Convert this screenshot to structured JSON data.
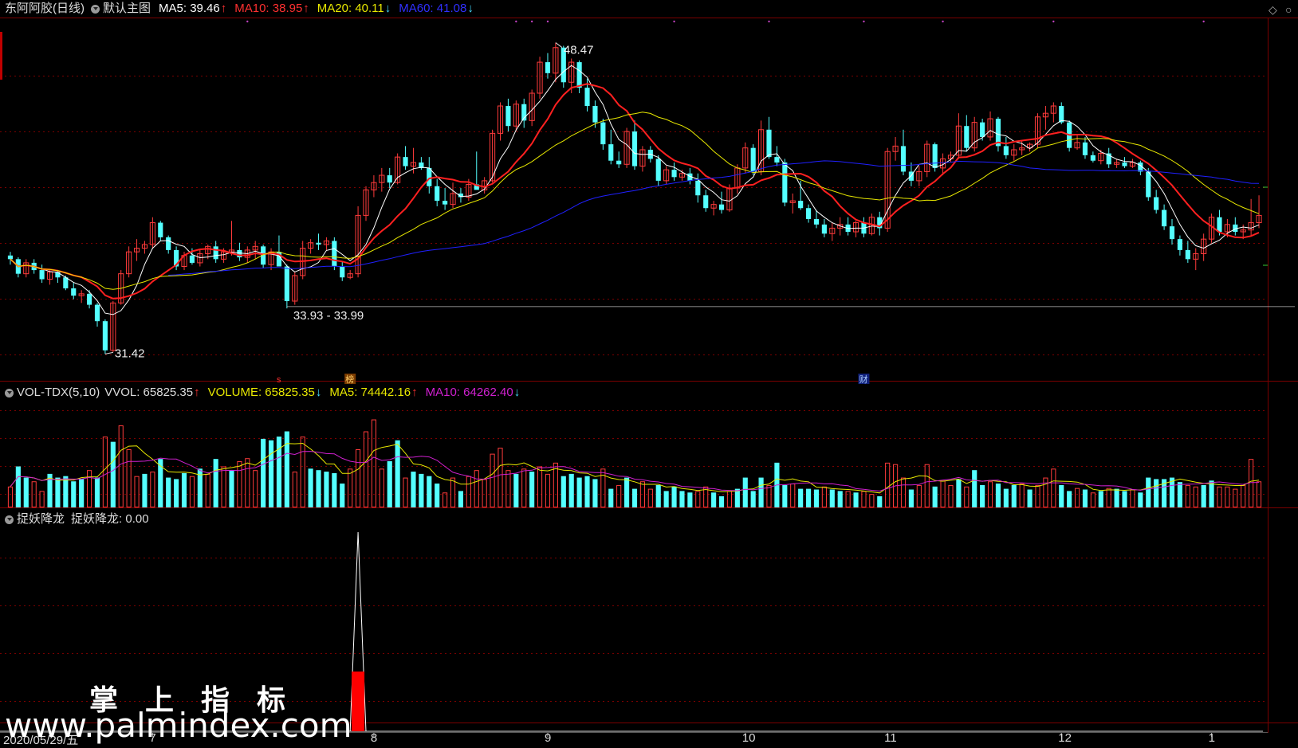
{
  "header_main": {
    "stock": "东阿阿胶(日线)",
    "chart_name": "默认主图",
    "ma5": "MA5: 39.46",
    "ma10": "MA10: 38.95",
    "ma20": "MA20: 40.11",
    "ma60": "MA60: 41.08"
  },
  "header_vol": {
    "name": "VOL-TDX(5,10)",
    "vvol": "VVOL: 65825.35",
    "volume": "VOLUME: 65825.35",
    "ma5": "MA5: 74442.16",
    "ma10": "MA10: 64262.40"
  },
  "header_ind": {
    "name": "捉妖降龙",
    "value": "捉妖降龙: 0.00"
  },
  "annotations": {
    "high": "48.47",
    "low": "31.42",
    "range": "33.93 - 33.99",
    "marker_s": "s",
    "marker_bang": "榜",
    "marker_cai": "财"
  },
  "x_axis": {
    "date": "2020/05/29/五",
    "months": [
      "7",
      "8",
      "9",
      "10",
      "11",
      "12",
      "1"
    ]
  },
  "watermark": {
    "line1": "掌上指标",
    "line2": "www.palmindex.com"
  },
  "colors": {
    "up": "#ff3b3b",
    "down": "#54ffff",
    "ma5": "#ffffff",
    "ma10": "#ff2020",
    "ma20": "#e8e800",
    "ma60": "#2020ff",
    "vol_ma5": "#e8e800",
    "vol_ma10": "#d020d0",
    "grid": "#7a0000"
  },
  "chart_data": {
    "type": "candlestick",
    "y_range": [
      30.5,
      49.5
    ],
    "candles": [
      [
        36.8,
        37.0,
        36.3,
        36.6
      ],
      [
        36.6,
        36.7,
        35.6,
        35.8
      ],
      [
        35.8,
        36.6,
        35.6,
        36.4
      ],
      [
        36.4,
        36.6,
        35.8,
        36.0
      ],
      [
        36.0,
        36.3,
        35.3,
        35.5
      ],
      [
        35.5,
        36.0,
        35.2,
        35.9
      ],
      [
        35.9,
        36.0,
        35.3,
        35.6
      ],
      [
        35.6,
        35.7,
        34.9,
        35.0
      ],
      [
        35.0,
        35.3,
        34.4,
        34.6
      ],
      [
        34.6,
        34.9,
        34.2,
        34.7
      ],
      [
        34.7,
        34.9,
        33.9,
        34.1
      ],
      [
        34.1,
        34.2,
        32.9,
        33.2
      ],
      [
        33.2,
        33.3,
        31.4,
        31.6
      ],
      [
        31.6,
        34.3,
        31.5,
        34.2
      ],
      [
        34.2,
        36.0,
        34.1,
        35.8
      ],
      [
        35.8,
        37.3,
        35.6,
        37.0
      ],
      [
        37.0,
        37.7,
        36.5,
        37.2
      ],
      [
        37.2,
        37.6,
        36.9,
        37.4
      ],
      [
        37.4,
        38.9,
        37.2,
        38.6
      ],
      [
        38.6,
        38.7,
        37.6,
        37.8
      ],
      [
        37.8,
        37.9,
        36.9,
        37.1
      ],
      [
        37.1,
        37.3,
        36.0,
        36.2
      ],
      [
        36.2,
        37.0,
        36.0,
        36.8
      ],
      [
        36.8,
        37.2,
        36.3,
        36.4
      ],
      [
        36.4,
        37.1,
        36.2,
        36.9
      ],
      [
        36.9,
        37.4,
        36.6,
        37.3
      ],
      [
        37.3,
        37.6,
        36.4,
        36.6
      ],
      [
        36.6,
        37.2,
        36.4,
        37.0
      ],
      [
        37.0,
        38.7,
        36.8,
        37.1
      ],
      [
        37.1,
        37.5,
        36.5,
        36.7
      ],
      [
        36.7,
        37.3,
        36.4,
        37.1
      ],
      [
        37.1,
        37.6,
        36.6,
        37.3
      ],
      [
        37.3,
        37.4,
        36.1,
        36.3
      ],
      [
        36.3,
        37.2,
        36.0,
        37.0
      ],
      [
        37.0,
        37.9,
        36.3,
        36.2
      ],
      [
        36.2,
        36.3,
        33.9,
        34.3
      ],
      [
        34.3,
        35.9,
        34.1,
        35.7
      ],
      [
        35.7,
        37.6,
        35.5,
        37.2
      ],
      [
        37.2,
        37.7,
        36.9,
        37.5
      ],
      [
        37.5,
        38.0,
        37.1,
        37.4
      ],
      [
        37.4,
        37.8,
        37.1,
        37.6
      ],
      [
        37.6,
        37.8,
        36.0,
        36.2
      ],
      [
        36.2,
        36.5,
        35.4,
        35.6
      ],
      [
        35.6,
        36.0,
        35.5,
        35.8
      ],
      [
        35.8,
        39.5,
        35.6,
        39.0
      ],
      [
        39.0,
        40.6,
        38.7,
        40.4
      ],
      [
        40.4,
        41.2,
        40.0,
        40.8
      ],
      [
        40.8,
        41.6,
        40.3,
        41.2
      ],
      [
        41.2,
        41.6,
        40.5,
        40.8
      ],
      [
        40.8,
        42.4,
        40.7,
        42.2
      ],
      [
        42.2,
        42.8,
        41.5,
        41.7
      ],
      [
        41.7,
        42.7,
        41.3,
        41.9
      ],
      [
        41.9,
        42.2,
        41.5,
        41.6
      ],
      [
        41.6,
        42.2,
        40.2,
        40.6
      ],
      [
        40.6,
        41.0,
        39.5,
        39.8
      ],
      [
        39.8,
        40.5,
        39.3,
        39.6
      ],
      [
        39.6,
        40.8,
        39.4,
        40.2
      ],
      [
        40.2,
        40.5,
        39.7,
        40.0
      ],
      [
        40.0,
        41.0,
        39.8,
        40.7
      ],
      [
        40.7,
        42.5,
        40.5,
        40.4
      ],
      [
        40.4,
        41.1,
        40.2,
        40.9
      ],
      [
        40.9,
        43.7,
        40.8,
        43.5
      ],
      [
        43.5,
        45.2,
        43.1,
        45.0
      ],
      [
        45.0,
        45.4,
        43.6,
        43.9
      ],
      [
        43.9,
        45.3,
        43.6,
        45.1
      ],
      [
        45.1,
        45.4,
        43.8,
        44.2
      ],
      [
        44.2,
        45.9,
        43.9,
        45.7
      ],
      [
        45.7,
        47.7,
        45.4,
        47.4
      ],
      [
        47.4,
        47.9,
        46.5,
        46.8
      ],
      [
        46.8,
        48.47,
        46.3,
        48.2
      ],
      [
        48.2,
        48.3,
        46.0,
        46.3
      ],
      [
        46.3,
        47.6,
        45.7,
        47.4
      ],
      [
        47.4,
        47.5,
        45.7,
        46.0
      ],
      [
        46.0,
        46.5,
        44.7,
        45.0
      ],
      [
        45.0,
        45.3,
        43.8,
        44.1
      ],
      [
        44.1,
        44.3,
        42.6,
        42.9
      ],
      [
        42.9,
        43.7,
        41.8,
        42.0
      ],
      [
        42.0,
        42.5,
        41.6,
        41.8
      ],
      [
        41.8,
        43.8,
        41.6,
        43.6
      ],
      [
        43.6,
        44.2,
        41.5,
        41.7
      ],
      [
        41.7,
        42.8,
        41.4,
        42.6
      ],
      [
        42.6,
        42.8,
        41.9,
        42.1
      ],
      [
        42.1,
        42.3,
        40.6,
        40.9
      ],
      [
        40.9,
        41.7,
        40.7,
        41.5
      ],
      [
        41.5,
        41.9,
        40.9,
        41.1
      ],
      [
        41.1,
        41.5,
        40.9,
        41.3
      ],
      [
        41.3,
        41.6,
        40.7,
        40.9
      ],
      [
        40.9,
        41.3,
        39.7,
        40.1
      ],
      [
        40.1,
        40.4,
        39.2,
        39.4
      ],
      [
        39.4,
        39.8,
        39.0,
        39.6
      ],
      [
        39.6,
        40.3,
        39.1,
        39.3
      ],
      [
        39.3,
        40.7,
        39.2,
        40.5
      ],
      [
        40.5,
        41.8,
        40.2,
        41.6
      ],
      [
        41.6,
        43.0,
        41.3,
        42.7
      ],
      [
        42.7,
        42.9,
        41.2,
        41.4
      ],
      [
        41.4,
        44.2,
        41.2,
        43.7
      ],
      [
        43.7,
        44.4,
        42.1,
        42.2
      ],
      [
        42.2,
        42.8,
        41.7,
        41.9
      ],
      [
        41.9,
        42.1,
        39.5,
        39.7
      ],
      [
        39.7,
        40.2,
        39.1,
        39.8
      ],
      [
        39.8,
        40.9,
        39.3,
        39.4
      ],
      [
        39.4,
        39.6,
        38.6,
        38.8
      ],
      [
        38.8,
        39.3,
        38.3,
        38.5
      ],
      [
        38.5,
        38.8,
        37.8,
        38.0
      ],
      [
        38.0,
        38.6,
        37.6,
        38.3
      ],
      [
        38.3,
        38.9,
        37.9,
        38.5
      ],
      [
        38.5,
        38.9,
        37.9,
        38.1
      ],
      [
        38.1,
        38.7,
        37.8,
        38.6
      ],
      [
        38.6,
        38.9,
        37.8,
        38.0
      ],
      [
        38.0,
        39.1,
        37.9,
        38.9
      ],
      [
        38.9,
        39.2,
        37.9,
        38.3
      ],
      [
        38.3,
        42.7,
        38.1,
        42.5
      ],
      [
        42.5,
        43.3,
        42.0,
        42.8
      ],
      [
        42.8,
        43.7,
        41.2,
        41.4
      ],
      [
        41.4,
        41.9,
        40.6,
        40.9
      ],
      [
        40.9,
        41.7,
        40.6,
        41.4
      ],
      [
        41.4,
        43.1,
        41.1,
        42.9
      ],
      [
        42.9,
        43.0,
        41.4,
        41.6
      ],
      [
        41.6,
        42.4,
        41.2,
        42.1
      ],
      [
        42.1,
        42.5,
        41.9,
        42.3
      ],
      [
        42.3,
        44.6,
        42.1,
        43.9
      ],
      [
        43.9,
        44.5,
        42.5,
        42.7
      ],
      [
        42.7,
        44.4,
        42.5,
        44.1
      ],
      [
        44.1,
        44.3,
        43.1,
        43.3
      ],
      [
        43.3,
        44.7,
        43.1,
        44.3
      ],
      [
        44.3,
        44.4,
        42.5,
        42.8
      ],
      [
        42.8,
        43.3,
        42.1,
        42.3
      ],
      [
        42.3,
        42.9,
        42.0,
        42.6
      ],
      [
        42.6,
        43.1,
        42.3,
        42.7
      ],
      [
        42.7,
        43.0,
        42.5,
        42.9
      ],
      [
        42.9,
        44.6,
        42.7,
        44.4
      ],
      [
        44.4,
        45.0,
        43.7,
        44.6
      ],
      [
        44.6,
        45.2,
        44.1,
        45.0
      ],
      [
        45.0,
        45.2,
        44.0,
        44.1
      ],
      [
        44.1,
        44.2,
        42.5,
        42.7
      ],
      [
        42.7,
        43.4,
        42.6,
        43.0
      ],
      [
        43.0,
        43.3,
        42.1,
        42.3
      ],
      [
        42.3,
        42.5,
        41.9,
        42.0
      ],
      [
        42.0,
        42.6,
        41.8,
        42.4
      ],
      [
        42.4,
        42.7,
        41.6,
        41.8
      ],
      [
        41.8,
        42.1,
        41.6,
        41.9
      ],
      [
        41.9,
        42.2,
        41.6,
        41.7
      ],
      [
        41.7,
        42.1,
        41.6,
        41.9
      ],
      [
        41.9,
        42.0,
        41.2,
        41.4
      ],
      [
        41.4,
        41.6,
        39.8,
        40.0
      ],
      [
        40.0,
        40.4,
        39.1,
        39.3
      ],
      [
        39.3,
        39.6,
        38.2,
        38.4
      ],
      [
        38.4,
        38.8,
        37.4,
        37.7
      ],
      [
        37.7,
        37.9,
        36.8,
        37.1
      ],
      [
        37.1,
        37.6,
        36.4,
        36.6
      ],
      [
        36.6,
        37.2,
        36.0,
        36.9
      ],
      [
        36.9,
        38.0,
        36.5,
        37.7
      ],
      [
        37.7,
        39.1,
        37.5,
        38.9
      ],
      [
        38.9,
        39.3,
        37.9,
        38.1
      ],
      [
        38.1,
        38.8,
        37.8,
        38.5
      ],
      [
        38.5,
        38.9,
        37.9,
        38.1
      ],
      [
        38.1,
        38.5,
        37.7,
        38.2
      ],
      [
        38.2,
        39.9,
        37.9,
        38.6
      ],
      [
        38.6,
        40.1,
        38.3,
        39.0
      ]
    ],
    "volumes": [
      [
        28,
        0
      ],
      [
        55,
        1
      ],
      [
        40,
        1
      ],
      [
        35,
        0
      ],
      [
        22,
        0
      ],
      [
        45,
        1
      ],
      [
        40,
        1
      ],
      [
        42,
        1
      ],
      [
        35,
        1
      ],
      [
        38,
        1
      ],
      [
        50,
        0
      ],
      [
        40,
        1
      ],
      [
        95,
        0
      ],
      [
        88,
        1
      ],
      [
        110,
        0
      ],
      [
        78,
        0
      ],
      [
        42,
        0
      ],
      [
        45,
        1
      ],
      [
        48,
        0
      ],
      [
        65,
        1
      ],
      [
        40,
        1
      ],
      [
        38,
        1
      ],
      [
        46,
        1
      ],
      [
        42,
        0
      ],
      [
        52,
        1
      ],
      [
        45,
        0
      ],
      [
        65,
        1
      ],
      [
        55,
        0
      ],
      [
        50,
        1
      ],
      [
        62,
        0
      ],
      [
        66,
        0
      ],
      [
        50,
        0
      ],
      [
        92,
        1
      ],
      [
        90,
        1
      ],
      [
        95,
        1
      ],
      [
        102,
        1
      ],
      [
        48,
        0
      ],
      [
        95,
        0
      ],
      [
        52,
        1
      ],
      [
        50,
        1
      ],
      [
        48,
        1
      ],
      [
        46,
        1
      ],
      [
        32,
        1
      ],
      [
        52,
        0
      ],
      [
        78,
        0
      ],
      [
        102,
        0
      ],
      [
        118,
        0
      ],
      [
        52,
        0
      ],
      [
        62,
        1
      ],
      [
        90,
        1
      ],
      [
        40,
        0
      ],
      [
        48,
        1
      ],
      [
        45,
        1
      ],
      [
        42,
        1
      ],
      [
        32,
        1
      ],
      [
        20,
        0
      ],
      [
        40,
        0
      ],
      [
        22,
        1
      ],
      [
        42,
        0
      ],
      [
        50,
        0
      ],
      [
        38,
        0
      ],
      [
        72,
        0
      ],
      [
        80,
        0
      ],
      [
        50,
        0
      ],
      [
        45,
        1
      ],
      [
        52,
        0
      ],
      [
        48,
        1
      ],
      [
        55,
        0
      ],
      [
        45,
        0
      ],
      [
        60,
        0
      ],
      [
        42,
        1
      ],
      [
        45,
        1
      ],
      [
        40,
        1
      ],
      [
        42,
        1
      ],
      [
        38,
        1
      ],
      [
        52,
        0
      ],
      [
        25,
        1
      ],
      [
        30,
        0
      ],
      [
        40,
        1
      ],
      [
        25,
        1
      ],
      [
        35,
        0
      ],
      [
        25,
        0
      ],
      [
        30,
        1
      ],
      [
        22,
        1
      ],
      [
        28,
        1
      ],
      [
        22,
        1
      ],
      [
        20,
        1
      ],
      [
        22,
        0
      ],
      [
        28,
        0
      ],
      [
        20,
        1
      ],
      [
        15,
        1
      ],
      [
        22,
        0
      ],
      [
        25,
        1
      ],
      [
        40,
        1
      ],
      [
        22,
        1
      ],
      [
        40,
        1
      ],
      [
        30,
        0
      ],
      [
        60,
        1
      ],
      [
        30,
        1
      ],
      [
        32,
        0
      ],
      [
        25,
        1
      ],
      [
        25,
        1
      ],
      [
        24,
        1
      ],
      [
        28,
        0
      ],
      [
        24,
        1
      ],
      [
        22,
        1
      ],
      [
        22,
        0
      ],
      [
        20,
        1
      ],
      [
        22,
        0
      ],
      [
        18,
        0
      ],
      [
        15,
        1
      ],
      [
        60,
        0
      ],
      [
        58,
        0
      ],
      [
        40,
        0
      ],
      [
        24,
        1
      ],
      [
        30,
        0
      ],
      [
        58,
        0
      ],
      [
        28,
        1
      ],
      [
        36,
        0
      ],
      [
        30,
        0
      ],
      [
        38,
        1
      ],
      [
        28,
        0
      ],
      [
        50,
        1
      ],
      [
        30,
        1
      ],
      [
        35,
        0
      ],
      [
        32,
        1
      ],
      [
        25,
        1
      ],
      [
        30,
        1
      ],
      [
        32,
        0
      ],
      [
        24,
        1
      ],
      [
        30,
        0
      ],
      [
        40,
        0
      ],
      [
        52,
        0
      ],
      [
        30,
        1
      ],
      [
        22,
        1
      ],
      [
        26,
        0
      ],
      [
        24,
        1
      ],
      [
        20,
        0
      ],
      [
        22,
        1
      ],
      [
        26,
        0
      ],
      [
        25,
        1
      ],
      [
        22,
        1
      ],
      [
        24,
        0
      ],
      [
        20,
        1
      ],
      [
        40,
        1
      ],
      [
        38,
        1
      ],
      [
        38,
        1
      ],
      [
        40,
        1
      ],
      [
        34,
        1
      ],
      [
        30,
        0
      ],
      [
        28,
        0
      ],
      [
        30,
        1
      ],
      [
        36,
        1
      ],
      [
        28,
        0
      ],
      [
        28,
        0
      ],
      [
        25,
        0
      ],
      [
        30,
        0
      ],
      [
        65,
        0
      ],
      [
        35,
        0
      ]
    ],
    "indicator": {
      "pulse_index": 44,
      "peak_value": 1.0,
      "bar_value": 0.3
    },
    "ma_periods": [
      5,
      10,
      20,
      60
    ],
    "vol_ma_periods": [
      5,
      10
    ]
  }
}
